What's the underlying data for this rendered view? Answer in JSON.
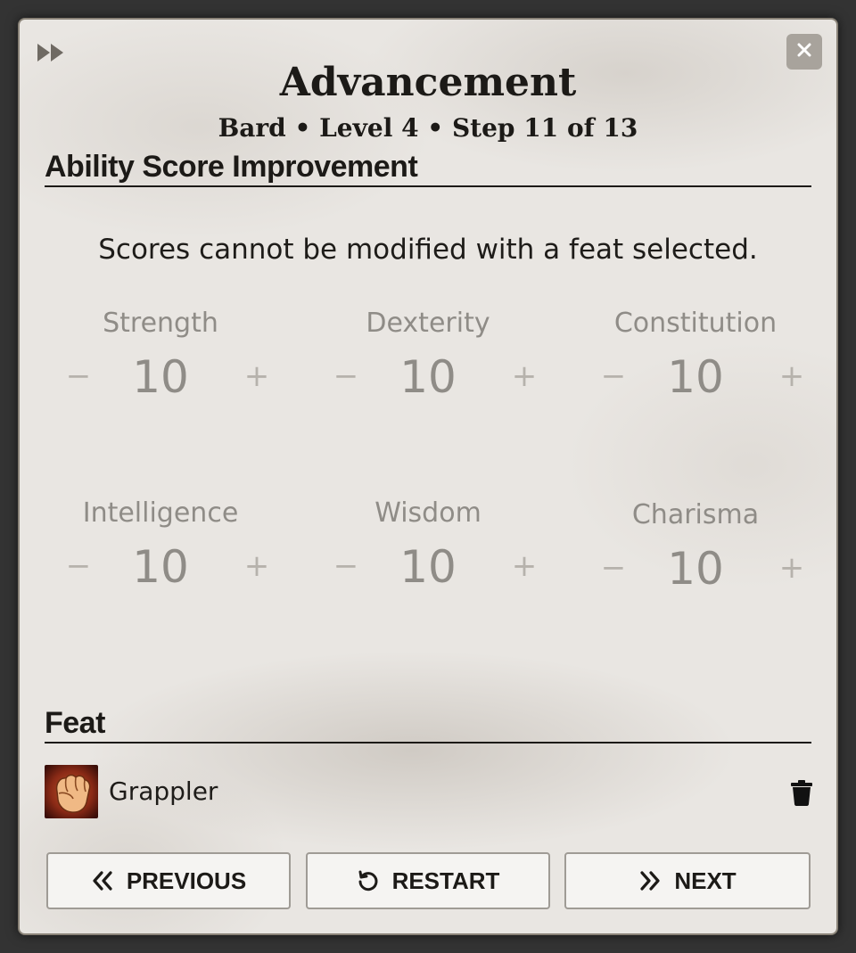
{
  "header": {
    "title": "Advancement",
    "subtitle": "Bard • Level 4 • Step 11 of 13"
  },
  "icons": {
    "skip": "fast-forward-icon",
    "close": "close-icon",
    "trash": "trash-icon",
    "previous": "double-chevron-left-icon",
    "restart": "restart-icon",
    "next": "double-chevron-right-icon"
  },
  "ability_section": {
    "heading": "Ability Score Improvement",
    "notice": "Scores cannot be modified with a feat selected.",
    "decrement_label": "−",
    "increment_label": "+",
    "abilities": [
      {
        "name": "Strength",
        "score": "10"
      },
      {
        "name": "Dexterity",
        "score": "10"
      },
      {
        "name": "Constitution",
        "score": "10"
      },
      {
        "name": "Intelligence",
        "score": "10"
      },
      {
        "name": "Wisdom",
        "score": "10"
      },
      {
        "name": "Charisma",
        "score": "10"
      }
    ]
  },
  "feat_section": {
    "heading": "Feat",
    "feat": {
      "name": "Grappler",
      "icon": "fist-icon"
    }
  },
  "footer": {
    "previous_label": "PREVIOUS",
    "restart_label": "RESTART",
    "next_label": "NEXT"
  },
  "colors": {
    "text_dark": "#1c1a17",
    "disabled_text": "#8f8c87",
    "parchment": "#e9e6e2",
    "close_button_bg": "#a8a39c"
  }
}
